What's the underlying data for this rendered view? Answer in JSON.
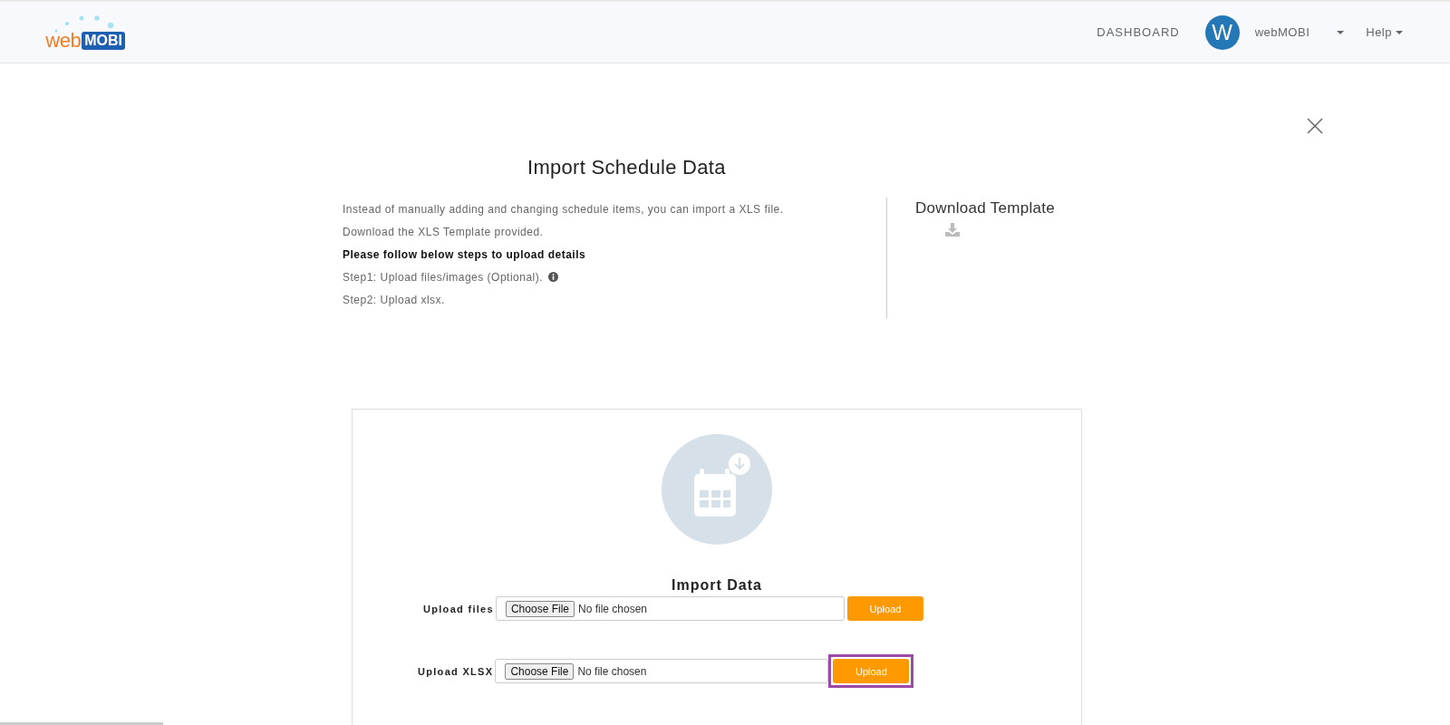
{
  "header": {
    "logo": {
      "part_1": "web",
      "part_2": "MOBI"
    },
    "nav_link": "DASHBOARD",
    "avatar_letter": "W",
    "user_name": "webMOBI",
    "help": "Help"
  },
  "dialog": {
    "title": "Import Schedule Data",
    "instructions": [
      {
        "text": "Instead of manually adding and changing schedule items, you can import a XLS file.",
        "bold": false,
        "info_icon": false
      },
      {
        "text": "Download the XLS Template provided.",
        "bold": false,
        "info_icon": false
      },
      {
        "text": "Please follow below steps to upload details",
        "bold": true,
        "info_icon": false
      },
      {
        "text": "Step1: Upload files/images (Optional).",
        "bold": false,
        "info_icon": true
      },
      {
        "text": "Step2: Upload xlsx.",
        "bold": false,
        "info_icon": false
      }
    ],
    "download_template": "Download Template",
    "import": {
      "title": "Import Data",
      "rows": [
        {
          "label": "Upload files",
          "choose_button": "Choose File",
          "file_status": "No file chosen",
          "upload_button": "Upload",
          "highlighted": false
        },
        {
          "label": "Upload XLSX",
          "choose_button": "Choose File",
          "file_status": "No file chosen",
          "upload_button": "Upload",
          "highlighted": true
        }
      ]
    }
  }
}
